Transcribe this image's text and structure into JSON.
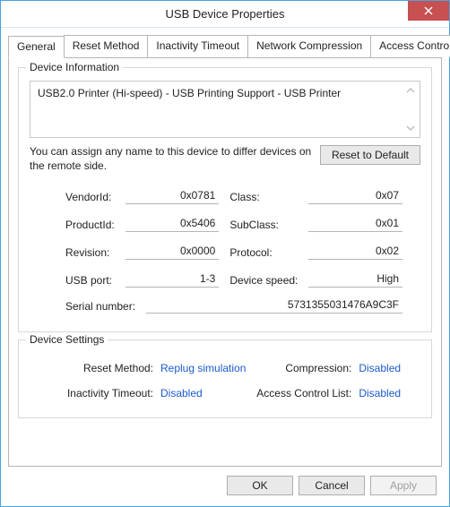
{
  "window": {
    "title": "USB Device Properties"
  },
  "tabs": [
    {
      "label": "General"
    },
    {
      "label": "Reset Method"
    },
    {
      "label": "Inactivity Timeout"
    },
    {
      "label": "Network Compression"
    },
    {
      "label": "Access Control List"
    }
  ],
  "group_info": {
    "title": "Device Information",
    "description": "USB2.0 Printer (Hi-speed) - USB Printing Support - USB Printer",
    "hint": "You can assign any name to this device to differ devices on the remote side.",
    "reset_btn": "Reset to Default",
    "fields": {
      "vendor_label": "VendorId:",
      "vendor_value": "0x0781",
      "class_label": "Class:",
      "class_value": "0x07",
      "product_label": "ProductId:",
      "product_value": "0x5406",
      "subclass_label": "SubClass:",
      "subclass_value": "0x01",
      "revision_label": "Revision:",
      "revision_value": "0x0000",
      "protocol_label": "Protocol:",
      "protocol_value": "0x02",
      "usbport_label": "USB port:",
      "usbport_value": "1-3",
      "speed_label": "Device speed:",
      "speed_value": "High",
      "serial_label": "Serial number:",
      "serial_value": "5731355031476A9C3F"
    }
  },
  "group_settings": {
    "title": "Device Settings",
    "reset_label": "Reset Method:",
    "reset_value": "Replug simulation",
    "compression_label": "Compression:",
    "compression_value": "Disabled",
    "timeout_label": "Inactivity Timeout:",
    "timeout_value": "Disabled",
    "acl_label": "Access Control List:",
    "acl_value": "Disabled"
  },
  "buttons": {
    "ok": "OK",
    "cancel": "Cancel",
    "apply": "Apply"
  }
}
